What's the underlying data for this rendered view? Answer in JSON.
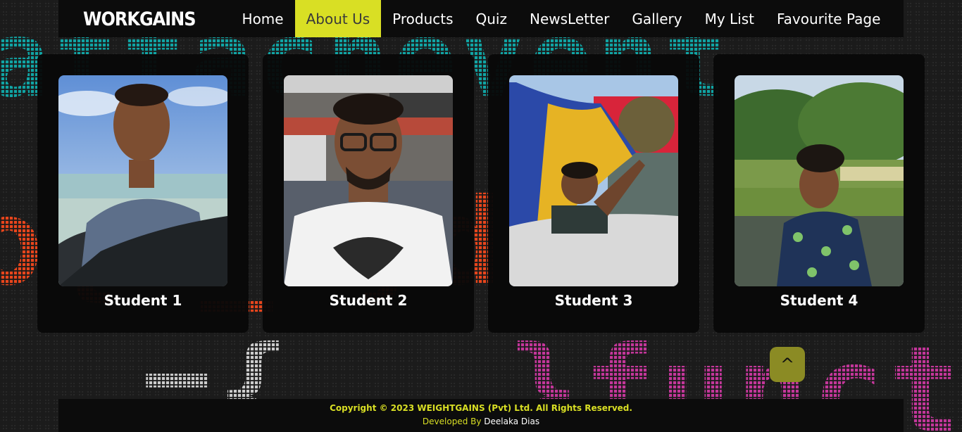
{
  "nav": {
    "logo": "WORKGAINS",
    "links": [
      "Home",
      "About Us",
      "Products",
      "Quiz",
      "NewsLetter",
      "Gallery",
      "My List",
      "Favourite Page"
    ],
    "active": "About Us",
    "active_color": "#d9df24"
  },
  "cards": [
    {
      "name": "Student 1"
    },
    {
      "name": "Student 2"
    },
    {
      "name": "Student 3"
    },
    {
      "name": "Student 4"
    }
  ],
  "back_to_top": {
    "label": "^",
    "icon": "chevron-up-icon"
  },
  "footer": {
    "copyright": "Copyright © 2023 WEIGHTGAINS (Pvt) Ltd. All Rights Reserved.",
    "developed_by": "Developed By",
    "developer": "Deelaka Dias"
  },
  "colors": {
    "accent": "#d9df24",
    "background": "#1b1b1b",
    "back_to_top": "#8b8b24"
  }
}
